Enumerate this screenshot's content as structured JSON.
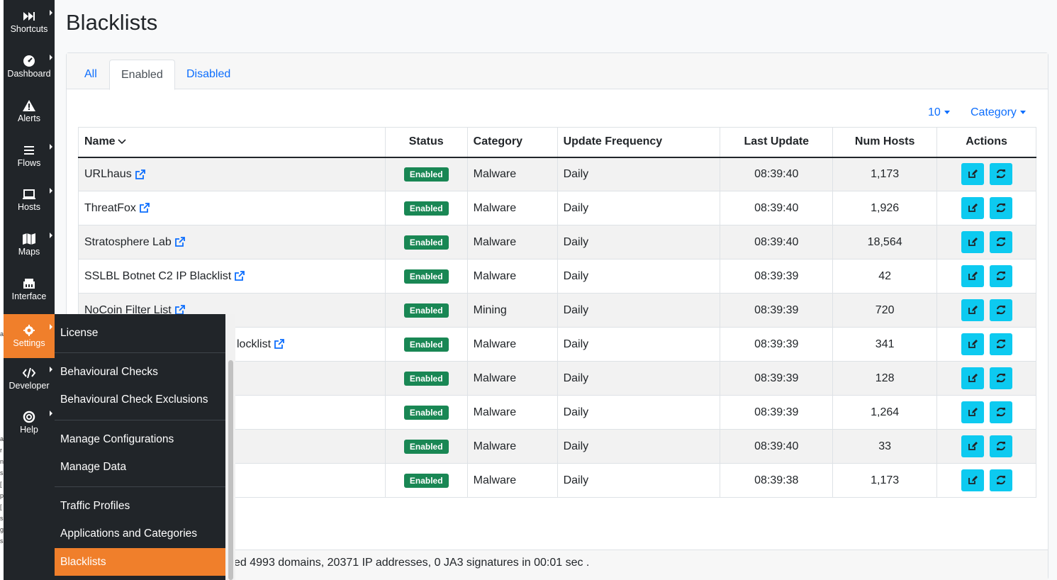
{
  "page": {
    "title": "Blacklists"
  },
  "sidebar": {
    "items": [
      {
        "label": "Shortcuts",
        "icon": "fast-forward-icon"
      },
      {
        "label": "Dashboard",
        "icon": "gauge-icon"
      },
      {
        "label": "Alerts",
        "icon": "warning-icon"
      },
      {
        "label": "Flows",
        "icon": "list-icon"
      },
      {
        "label": "Hosts",
        "icon": "laptop-icon"
      },
      {
        "label": "Maps",
        "icon": "map-icon"
      },
      {
        "label": "Interface",
        "icon": "network-icon"
      },
      {
        "label": "Settings",
        "icon": "gear-icon"
      },
      {
        "label": "Developer",
        "icon": "code-icon"
      },
      {
        "label": "Help",
        "icon": "life-ring-icon"
      }
    ]
  },
  "submenu": {
    "items": [
      "License",
      "Behavioural Checks",
      "Behavioural Check Exclusions",
      "Manage Configurations",
      "Manage Data",
      "Traffic Profiles",
      "Applications and Categories",
      "Blacklists"
    ]
  },
  "tabs": [
    "All",
    "Enabled",
    "Disabled"
  ],
  "controls": {
    "page_size": "10",
    "category": "Category"
  },
  "table": {
    "headers": [
      "Name",
      "Status",
      "Category",
      "Update Frequency",
      "Last Update",
      "Num Hosts",
      "Actions"
    ],
    "rows": [
      {
        "name": "URLhaus",
        "status": "Enabled",
        "category": "Malware",
        "freq": "Daily",
        "last": "08:39:40",
        "hosts": "1,173"
      },
      {
        "name": "ThreatFox",
        "status": "Enabled",
        "category": "Malware",
        "freq": "Daily",
        "last": "08:39:40",
        "hosts": "1,926"
      },
      {
        "name": "Stratosphere Lab",
        "status": "Enabled",
        "category": "Malware",
        "freq": "Daily",
        "last": "08:39:40",
        "hosts": "18,564"
      },
      {
        "name": "SSLBL Botnet C2 IP Blacklist",
        "status": "Enabled",
        "category": "Malware",
        "freq": "Daily",
        "last": "08:39:39",
        "hosts": "42"
      },
      {
        "name": "NoCoin Filter List",
        "status": "Enabled",
        "category": "Mining",
        "freq": "Daily",
        "last": "08:39:39",
        "hosts": "720"
      },
      {
        "name": "locklist",
        "status": "Enabled",
        "category": "Malware",
        "freq": "Daily",
        "last": "08:39:39",
        "hosts": "341"
      },
      {
        "name": "",
        "status": "Enabled",
        "category": "Malware",
        "freq": "Daily",
        "last": "08:39:39",
        "hosts": "128"
      },
      {
        "name": "",
        "status": "Enabled",
        "category": "Malware",
        "freq": "Daily",
        "last": "08:39:39",
        "hosts": "1,264"
      },
      {
        "name": "",
        "status": "Enabled",
        "category": "Malware",
        "freq": "Daily",
        "last": "08:39:40",
        "hosts": "33"
      },
      {
        "name": "",
        "status": "Enabled",
        "category": "Malware",
        "freq": "Daily",
        "last": "08:39:38",
        "hosts": "1,173"
      }
    ]
  },
  "footer": {
    "text": "ed 4993 domains, 20371 IP addresses, 0 JA3 signatures in 00:01 sec ."
  },
  "colors": {
    "accent": "#f07f2b",
    "link": "#0d6efd",
    "badge": "#198754",
    "action_button": "#0dcaf0"
  }
}
